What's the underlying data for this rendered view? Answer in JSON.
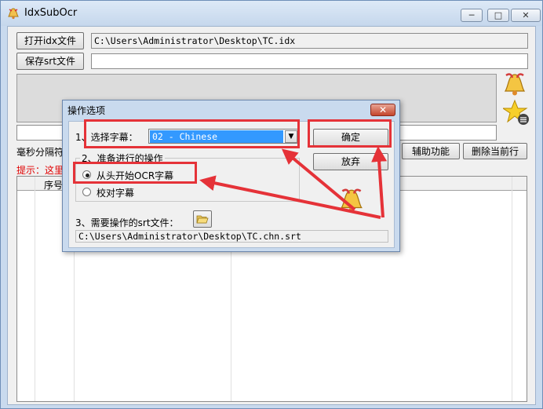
{
  "window": {
    "title": "IdxSubOcr",
    "controls": {
      "minimize": "─",
      "maximize": "□",
      "close": "✕"
    }
  },
  "main": {
    "open_idx_button": "打开idx文件",
    "idx_path": "C:\\Users\\Administrator\\Desktop\\TC.idx",
    "save_srt_button": "保存srt文件",
    "srt_path": "",
    "ms_label": "毫秒分隔符",
    "tip_text": "提示：这里",
    "assist_button": "辅助功能",
    "delete_row_button": "删除当前行",
    "grid_headers": [
      "序号"
    ]
  },
  "dialog": {
    "title": "操作选项",
    "close": "✕",
    "step1_label": "1、选择字幕：",
    "subtitle_selected": "02 - Chinese",
    "ok_button": "确定",
    "cancel_button": "放弃",
    "group_title": "2、准备进行的操作",
    "option_ocr": "从头开始OCR字幕",
    "option_proofread": "校对字幕",
    "option_ocr_checked": true,
    "step3_label": "3、需要操作的srt文件：",
    "srt_output_path": "C:\\Users\\Administrator\\Desktop\\TC.chn.srt"
  },
  "colors": {
    "annotation_red": "#e53238",
    "selection_blue": "#3399ff",
    "tip_red": "#e00000"
  },
  "icons": [
    "bell-icon",
    "star-list-icon",
    "folder-open-icon"
  ]
}
